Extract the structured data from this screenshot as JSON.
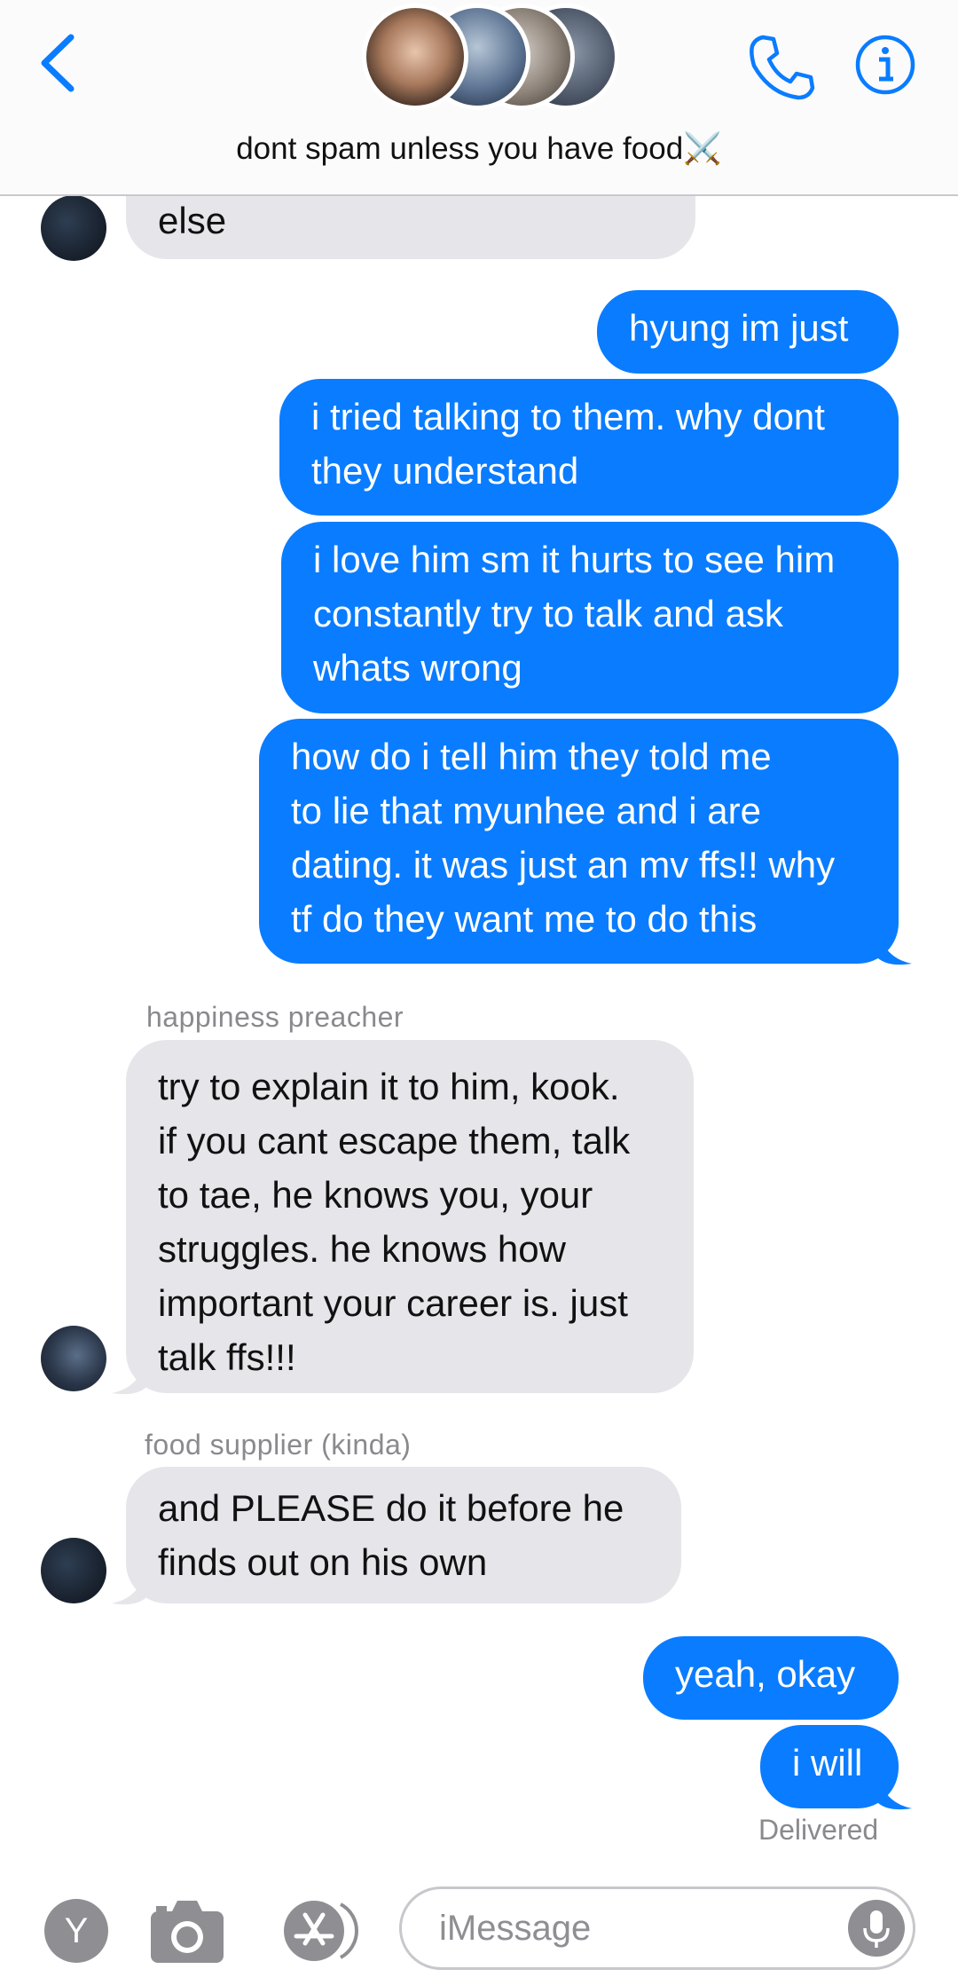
{
  "header": {
    "group_title": "dont spam unless you have food",
    "title_emoji": "⚔️",
    "back_icon": "chevron-left-icon",
    "call_icon": "phone-icon",
    "info_icon": "info-icon",
    "accent": "#0a7cff"
  },
  "messages": [
    {
      "type": "incoming",
      "text_lines": [
        "else"
      ]
    },
    {
      "type": "outgoing",
      "text_lines": [
        "hyung im just"
      ]
    },
    {
      "type": "outgoing",
      "text_lines": [
        "i tried talking to them. why dont",
        "they understand"
      ]
    },
    {
      "type": "outgoing",
      "text_lines": [
        "i love him sm it hurts to see him",
        "constantly try to talk and ask",
        "whats wrong"
      ]
    },
    {
      "type": "outgoing",
      "text_lines": [
        "how do i tell him they told me",
        "to lie that myunhee and i are",
        "dating. it was just an mv ffs!! why",
        "tf do they want me to do this"
      ]
    },
    {
      "type": "incoming",
      "sender": "happiness preacher",
      "text_lines": [
        "try to explain it to him, kook.",
        "if you cant escape them, talk",
        "to tae, he knows you, your",
        "struggles. he knows how",
        "important your career is. just",
        "talk ffs!!!"
      ]
    },
    {
      "type": "incoming",
      "sender": "food supplier (kinda)",
      "text_lines": [
        "and PLEASE do it before he",
        "finds out on his own"
      ]
    },
    {
      "type": "outgoing",
      "text_lines": [
        "yeah, okay"
      ]
    },
    {
      "type": "outgoing",
      "text_lines": [
        "i will"
      ]
    }
  ],
  "status": {
    "delivered": "Delivered"
  },
  "composer": {
    "placeholder": "iMessage",
    "memoji_letter": "Y",
    "camera_icon": "camera-icon",
    "appstore_icon": "appstore-icon",
    "mic_icon": "microphone-icon"
  },
  "colors": {
    "outgoing": "#0a7cff",
    "incoming": "#e5e5ea",
    "muted": "#8a8a8e"
  }
}
